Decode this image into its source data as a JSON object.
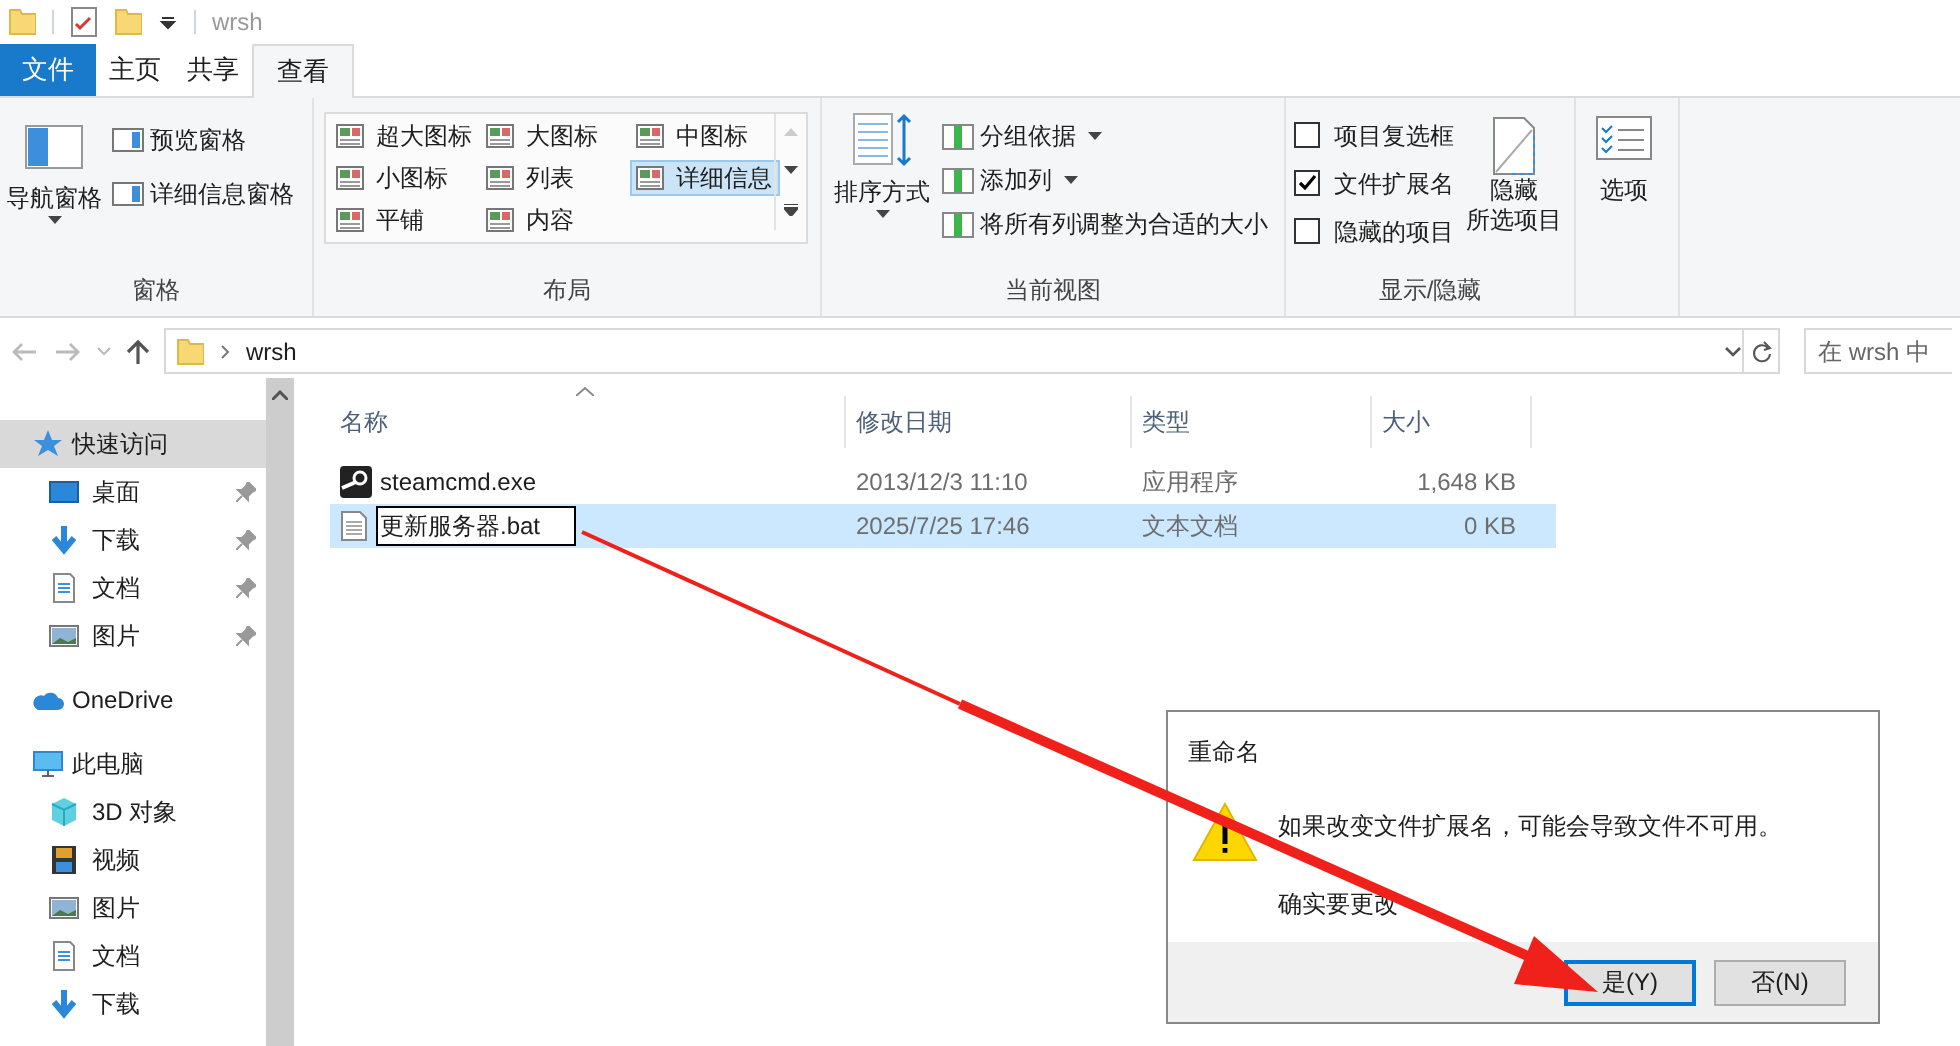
{
  "title_bar": {
    "title": "wrsh"
  },
  "ribbon_tabs": [
    {
      "label": "文件",
      "kind": "file",
      "selected": false
    },
    {
      "label": "主页",
      "kind": "tab",
      "selected": false
    },
    {
      "label": "共享",
      "kind": "tab",
      "selected": false
    },
    {
      "label": "查看",
      "kind": "tab",
      "selected": true
    }
  ],
  "ribbon": {
    "panes": {
      "label": "窗格",
      "nav_pane": "导航窗格",
      "items": [
        "预览窗格",
        "详细信息窗格"
      ]
    },
    "layout": {
      "label": "布局",
      "options": [
        {
          "label": "超大图标",
          "selected": false
        },
        {
          "label": "大图标",
          "selected": false
        },
        {
          "label": "中图标",
          "selected": false
        },
        {
          "label": "小图标",
          "selected": false
        },
        {
          "label": "列表",
          "selected": false
        },
        {
          "label": "详细信息",
          "selected": true
        },
        {
          "label": "平铺",
          "selected": false
        },
        {
          "label": "内容",
          "selected": false
        }
      ]
    },
    "current_view": {
      "label": "当前视图",
      "sort_by": "排序方式",
      "items": [
        {
          "label": "分组依据",
          "dropdown": true
        },
        {
          "label": "添加列",
          "dropdown": true
        },
        {
          "label": "将所有列调整为合适的大小",
          "dropdown": false
        }
      ]
    },
    "show_hide": {
      "label": "显示/隐藏",
      "checkboxes": [
        {
          "label": "项目复选框",
          "checked": false
        },
        {
          "label": "文件扩展名",
          "checked": true
        },
        {
          "label": "隐藏的项目",
          "checked": false
        }
      ],
      "hide_selected": [
        "隐藏",
        "所选项目"
      ]
    },
    "options": {
      "label": "选项"
    }
  },
  "address": {
    "path": "wrsh",
    "search_placeholder": "在 wrsh 中"
  },
  "sidebar": {
    "items": [
      {
        "label": "快速访问",
        "kind": "star",
        "selected": true,
        "children": [
          {
            "label": "桌面",
            "kind": "desktop",
            "pinned": true
          },
          {
            "label": "下载",
            "kind": "download",
            "pinned": true
          },
          {
            "label": "文档",
            "kind": "document",
            "pinned": true
          },
          {
            "label": "图片",
            "kind": "pictures",
            "pinned": true
          }
        ]
      },
      {
        "label": "OneDrive",
        "kind": "cloud",
        "selected": false
      },
      {
        "label": "此电脑",
        "kind": "computer",
        "selected": false,
        "children": [
          {
            "label": "3D 对象",
            "kind": "cube",
            "pinned": false
          },
          {
            "label": "视频",
            "kind": "video",
            "pinned": false
          },
          {
            "label": "图片",
            "kind": "pictures",
            "pinned": false
          },
          {
            "label": "文档",
            "kind": "document",
            "pinned": false
          },
          {
            "label": "下载",
            "kind": "download",
            "pinned": false
          }
        ]
      }
    ]
  },
  "files": {
    "columns": [
      "名称",
      "修改日期",
      "类型",
      "大小"
    ],
    "rows": [
      {
        "name": "steamcmd.exe",
        "kind": "app",
        "date": "2013/12/3 11:10",
        "type": "应用程序",
        "size": "1,648 KB",
        "selected": false,
        "renaming": false
      },
      {
        "name": "更新服务器.bat",
        "kind": "text",
        "date": "2025/7/25 17:46",
        "type": "文本文档",
        "size": "0 KB",
        "selected": true,
        "renaming": true
      }
    ]
  },
  "dialog": {
    "title": "重命名",
    "message": "如果改变文件扩展名，可能会导致文件不可用。",
    "question": "确实要更改",
    "buttons": [
      {
        "label": "是(Y)",
        "default": true
      },
      {
        "label": "否(N)",
        "default": false
      }
    ]
  }
}
